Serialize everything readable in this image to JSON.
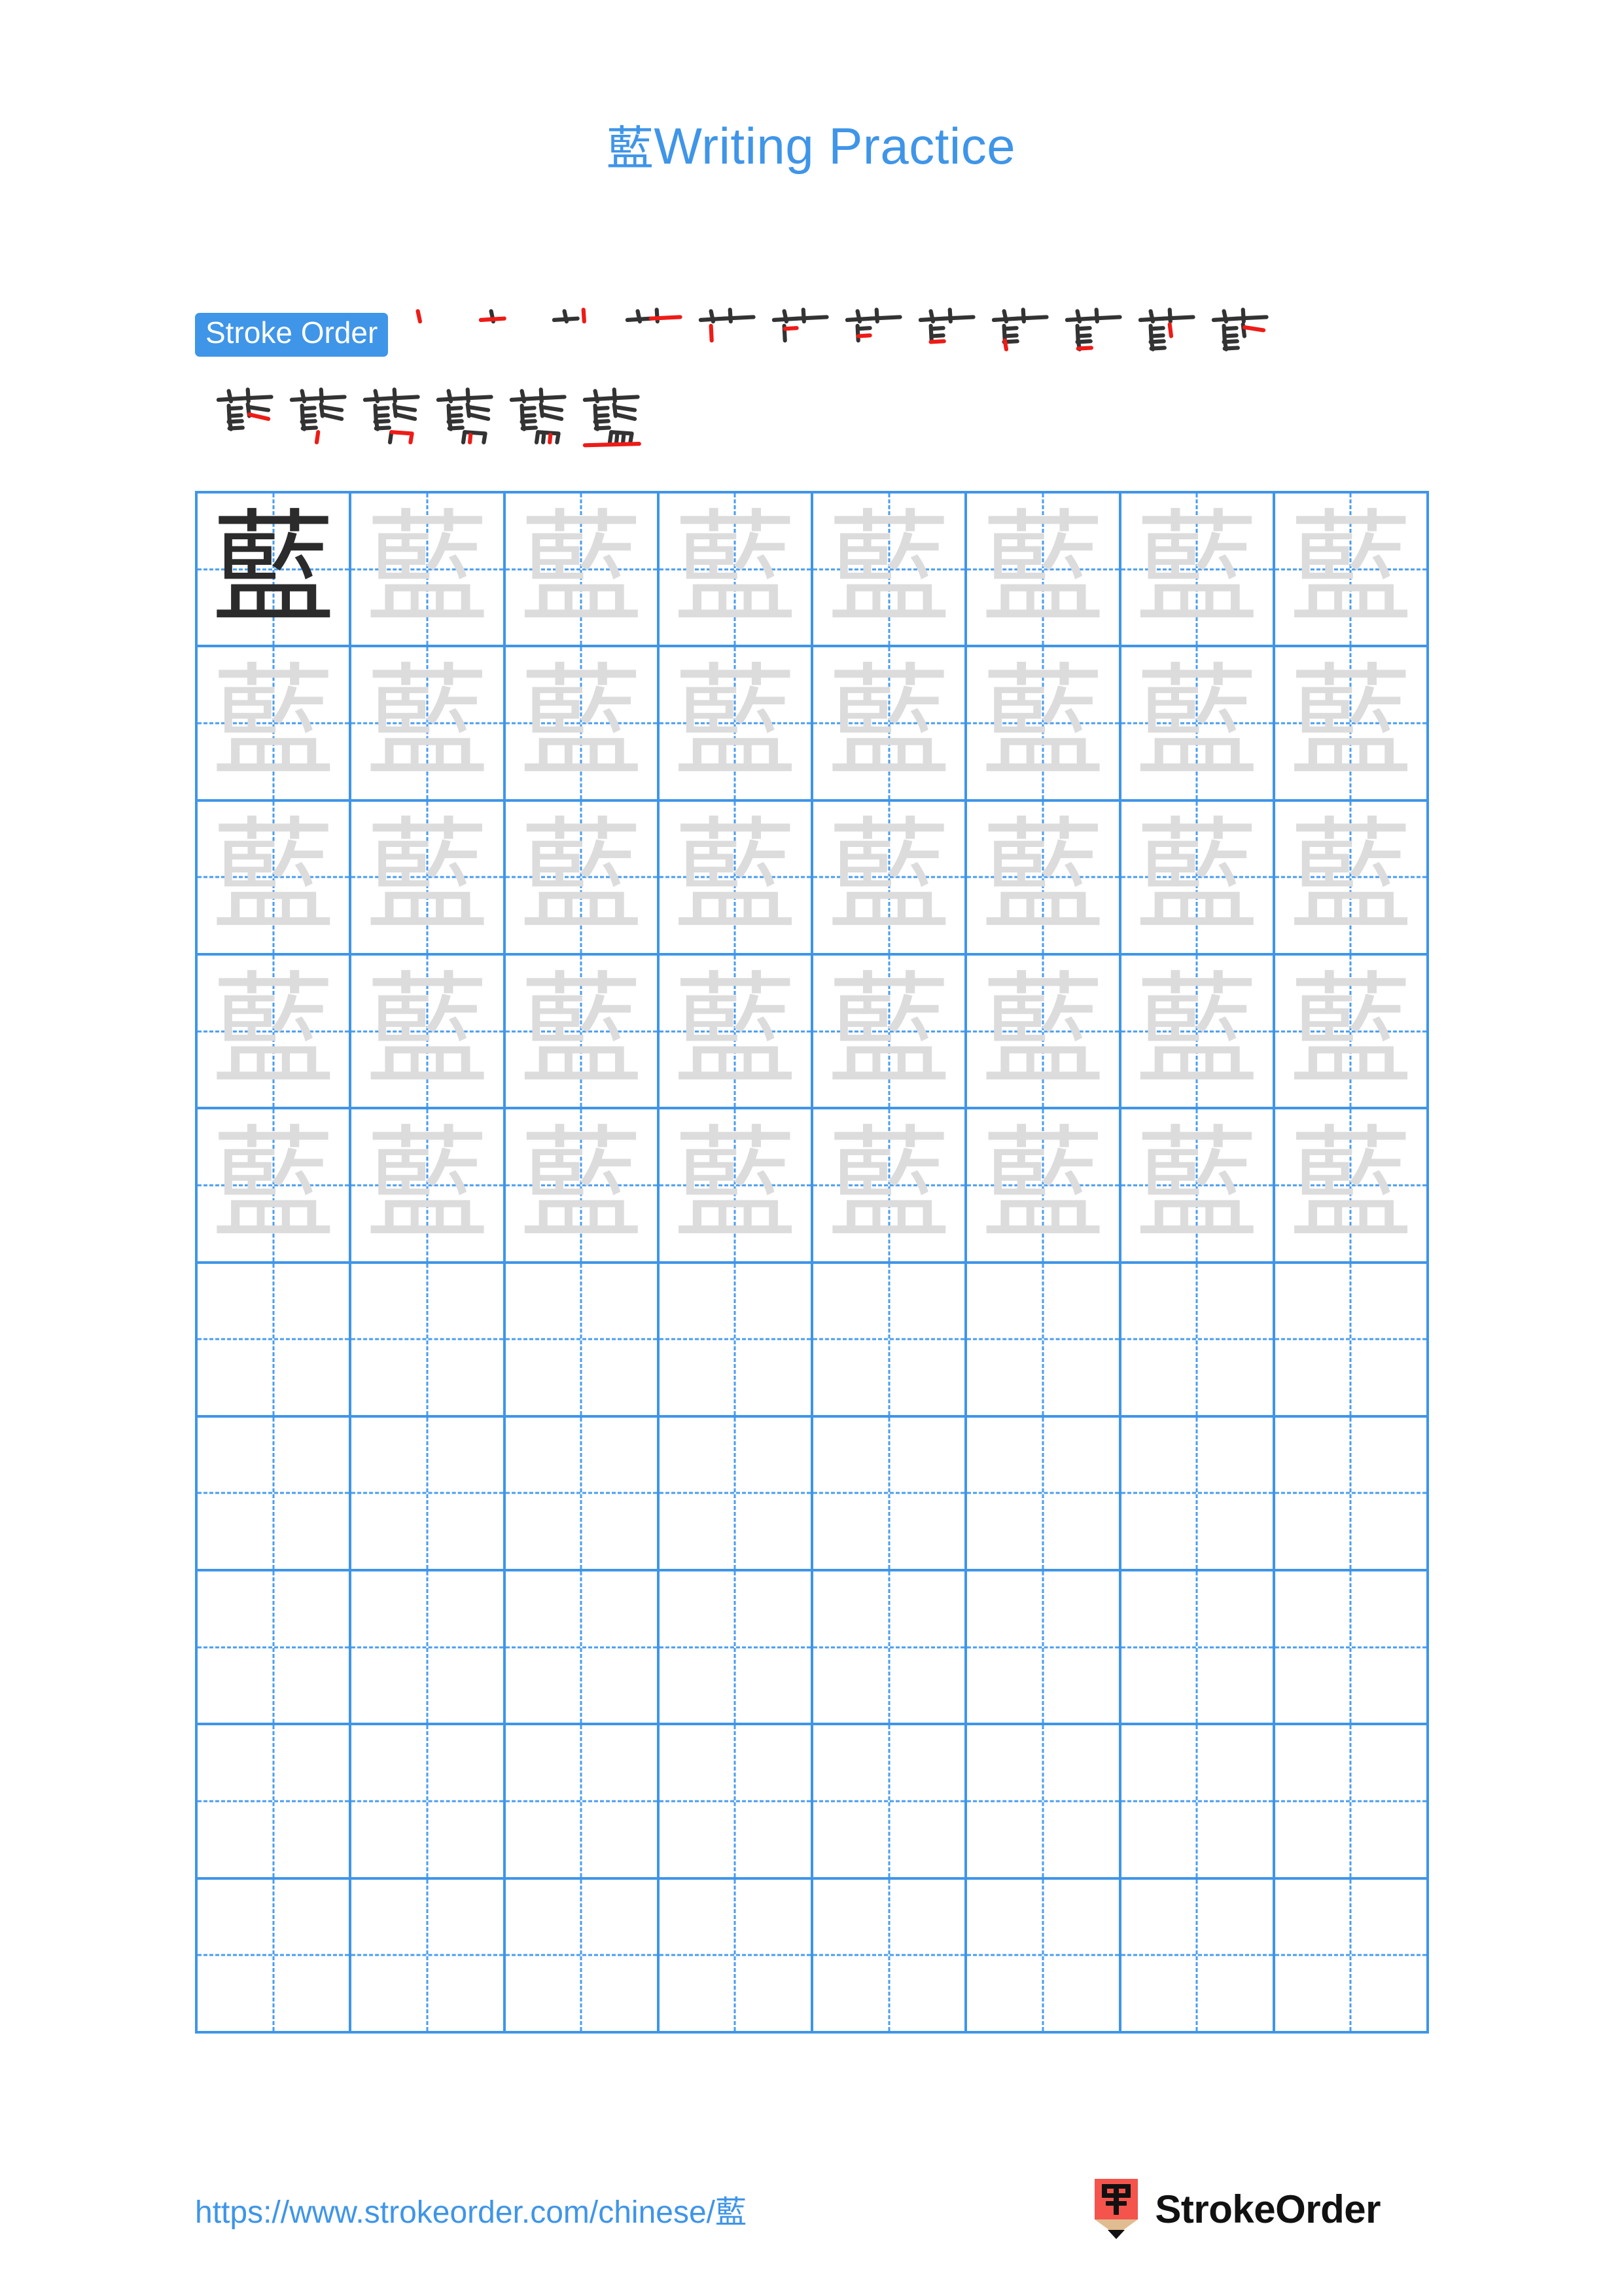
{
  "page": {
    "character": "藍",
    "title_suffix": " Writing Practice",
    "background": "#ffffff"
  },
  "title": {
    "character": "藍",
    "text": "Writing Practice",
    "color": "#3f95e8"
  },
  "stroke_order": {
    "badge_label": "Stroke Order",
    "badge_bg": "#3f95e8",
    "badge_text_color": "#ffffff",
    "total_strokes": 18,
    "new_stroke_color": "#ee1b17",
    "existing_stroke_color": "#333333",
    "row1_count": 12,
    "row2_count": 6,
    "steps": [
      {
        "index": 1,
        "label": "stroke-1"
      },
      {
        "index": 2,
        "label": "stroke-2"
      },
      {
        "index": 3,
        "label": "stroke-3"
      },
      {
        "index": 4,
        "label": "stroke-4"
      },
      {
        "index": 5,
        "label": "stroke-5"
      },
      {
        "index": 6,
        "label": "stroke-6"
      },
      {
        "index": 7,
        "label": "stroke-7"
      },
      {
        "index": 8,
        "label": "stroke-8"
      },
      {
        "index": 9,
        "label": "stroke-9"
      },
      {
        "index": 10,
        "label": "stroke-10"
      },
      {
        "index": 11,
        "label": "stroke-11"
      },
      {
        "index": 12,
        "label": "stroke-12"
      },
      {
        "index": 13,
        "label": "stroke-13"
      },
      {
        "index": 14,
        "label": "stroke-14"
      },
      {
        "index": 15,
        "label": "stroke-15"
      },
      {
        "index": 16,
        "label": "stroke-16"
      },
      {
        "index": 17,
        "label": "stroke-17"
      },
      {
        "index": 18,
        "label": "stroke-18"
      }
    ]
  },
  "practice_grid": {
    "columns": 8,
    "rows": 10,
    "grid_line_color": "#3f95e8",
    "guide_line_color": "#4a9def",
    "model_char_color": "#2b2b2b",
    "trace_char_color": "#dcdcdc",
    "cells": [
      [
        "model",
        "trace",
        "trace",
        "trace",
        "trace",
        "trace",
        "trace",
        "trace"
      ],
      [
        "trace",
        "trace",
        "trace",
        "trace",
        "trace",
        "trace",
        "trace",
        "trace"
      ],
      [
        "trace",
        "trace",
        "trace",
        "trace",
        "trace",
        "trace",
        "trace",
        "trace"
      ],
      [
        "trace",
        "trace",
        "trace",
        "trace",
        "trace",
        "trace",
        "trace",
        "trace"
      ],
      [
        "trace",
        "trace",
        "trace",
        "trace",
        "trace",
        "trace",
        "trace",
        "trace"
      ],
      [
        "blank",
        "blank",
        "blank",
        "blank",
        "blank",
        "blank",
        "blank",
        "blank"
      ],
      [
        "blank",
        "blank",
        "blank",
        "blank",
        "blank",
        "blank",
        "blank",
        "blank"
      ],
      [
        "blank",
        "blank",
        "blank",
        "blank",
        "blank",
        "blank",
        "blank",
        "blank"
      ],
      [
        "blank",
        "blank",
        "blank",
        "blank",
        "blank",
        "blank",
        "blank",
        "blank"
      ],
      [
        "blank",
        "blank",
        "blank",
        "blank",
        "blank",
        "blank",
        "blank",
        "blank"
      ]
    ]
  },
  "footer": {
    "url": "https://www.strokeorder.com/chinese/藍",
    "url_color": "#3f95e8",
    "brand_name": "StrokeOrder",
    "logo_character": "字",
    "logo_body_color": "#f4544c",
    "logo_wood_color": "#e0bc91",
    "logo_tip_color": "#111111"
  }
}
